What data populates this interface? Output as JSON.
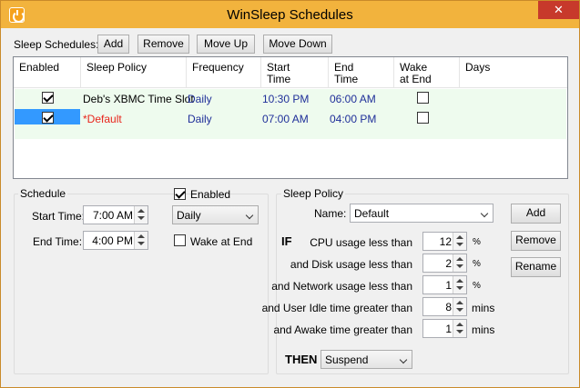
{
  "window": {
    "title": "WinSleep Schedules",
    "close_glyph": "✕"
  },
  "toolbar": {
    "label": "Sleep Schedules:",
    "add": "Add",
    "remove": "Remove",
    "move_up": "Move Up",
    "move_down": "Move Down"
  },
  "list": {
    "columns": [
      {
        "line1": "Enabled",
        "line2": ""
      },
      {
        "line1": "Sleep Policy",
        "line2": ""
      },
      {
        "line1": "Frequency",
        "line2": ""
      },
      {
        "line1": "Start",
        "line2": "Time"
      },
      {
        "line1": "End",
        "line2": "Time"
      },
      {
        "line1": "Wake",
        "line2": "at End"
      },
      {
        "line1": "Days",
        "line2": ""
      }
    ],
    "rows": [
      {
        "enabled": true,
        "policy": "Deb's XBMC Time Slot",
        "frequency": "Daily",
        "start": "10:30 PM",
        "end": "06:00 AM",
        "wake": false,
        "days": ""
      },
      {
        "enabled": true,
        "policy": "*Default",
        "frequency": "Daily",
        "start": "07:00 AM",
        "end": "04:00 PM",
        "wake": false,
        "days": ""
      }
    ]
  },
  "schedule": {
    "group_title": "Schedule",
    "enabled_label": "Enabled",
    "enabled": true,
    "start_label": "Start Time:",
    "start_value": "7:00 AM",
    "end_label": "End Time:",
    "end_value": "4:00 PM",
    "frequency": "Daily",
    "wake_label": "Wake at End",
    "wake": false
  },
  "policy": {
    "group_title": "Sleep Policy",
    "name_label": "Name:",
    "name_value": "Default",
    "add": "Add",
    "remove": "Remove",
    "rename": "Rename",
    "if_label": "IF",
    "then_label": "THEN",
    "then_value": "Suspend",
    "conditions": [
      {
        "label": "CPU usage less than",
        "value": "12",
        "unit": "%"
      },
      {
        "label": "and Disk usage less than",
        "value": "2",
        "unit": "%"
      },
      {
        "label": "and Network usage less than",
        "value": "1",
        "unit": "%"
      },
      {
        "label": "and User Idle time greater than",
        "value": "8",
        "unit": "mins"
      },
      {
        "label": "and Awake time greater than",
        "value": "1",
        "unit": "mins"
      }
    ]
  },
  "colors": {
    "titlebar": "#f2b33d",
    "list_bg": "#eefbee",
    "cell_blue": "#1f2f99",
    "default_red": "#e8241b",
    "selection": "#3399ff"
  }
}
